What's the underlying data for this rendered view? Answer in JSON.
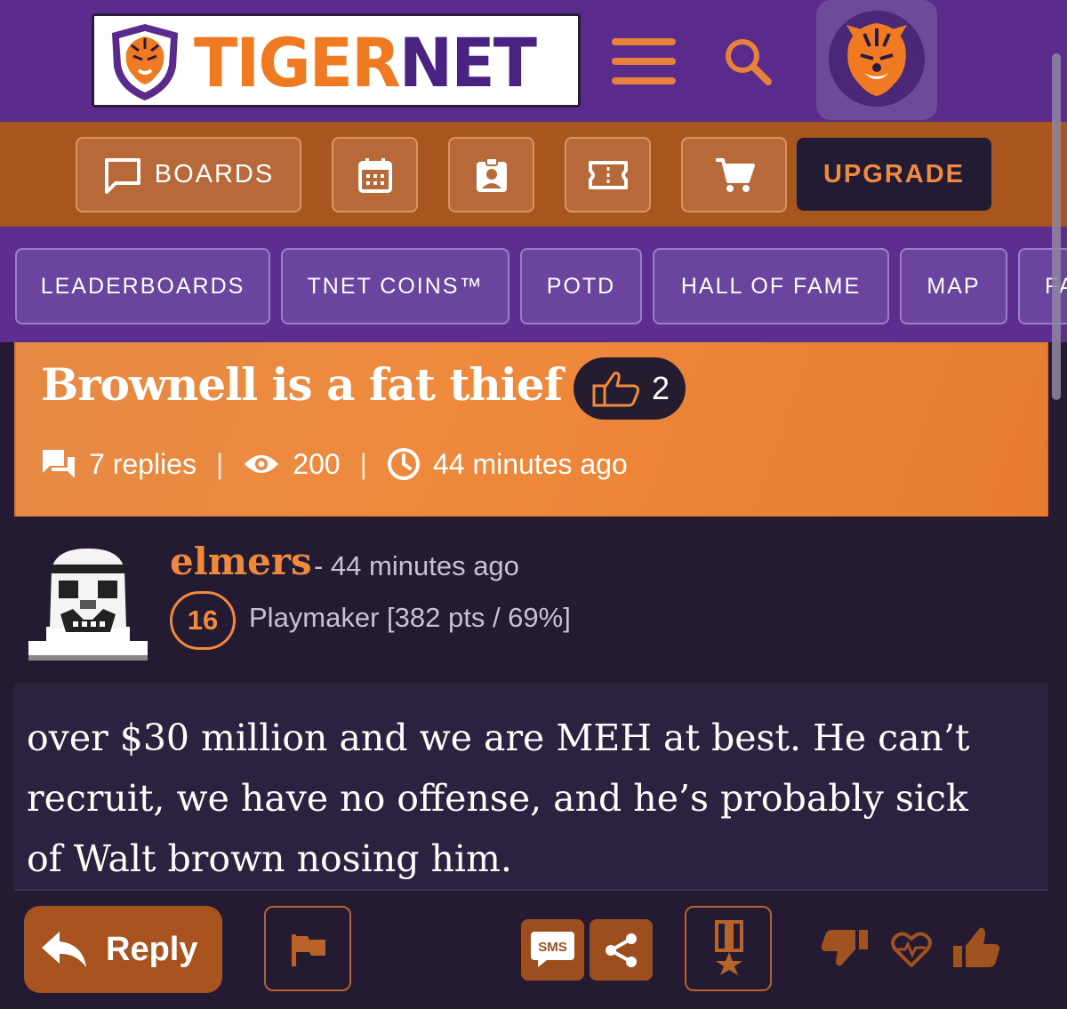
{
  "brand": {
    "name_part1": "TIGER",
    "name_part2": "NET",
    "accent": "#f07a22",
    "purple": "#5a2b8c"
  },
  "header_icons": [
    "hamburger-icon",
    "search-icon",
    "tiger-avatar-icon"
  ],
  "toolbar": {
    "boards_label": "BOARDS",
    "upgrade_label": "UPGRADE",
    "icons": [
      "chat-icon",
      "calendar-icon",
      "id-badge-icon",
      "ticket-icon",
      "cart-icon"
    ]
  },
  "tabs": [
    {
      "label": "LEADERBOARDS"
    },
    {
      "label": "TNET COINS™"
    },
    {
      "label": "POTD"
    },
    {
      "label": "HALL OF FAME"
    },
    {
      "label": "MAP"
    },
    {
      "label": "FA"
    }
  ],
  "thread": {
    "title": "Brownell is a fat thief",
    "likes": "2",
    "replies": "7 replies",
    "views": "200",
    "posted": "44 minutes ago"
  },
  "post": {
    "username": "elmers",
    "time": "- 44 minutes ago",
    "level": "16",
    "rank": "Playmaker [382 pts / 69%]",
    "body": "over $30 million and we are MEH at best. He can’t recruit, we have no offense, and he’s probably sick of Walt brown nosing him."
  },
  "actions": {
    "reply_label": "Reply",
    "sms_label": "SMS",
    "icons": [
      "flag-icon",
      "sms-icon",
      "share-icon",
      "medal-icon",
      "thumbs-down-icon",
      "heart-icon",
      "thumbs-up-icon"
    ]
  }
}
